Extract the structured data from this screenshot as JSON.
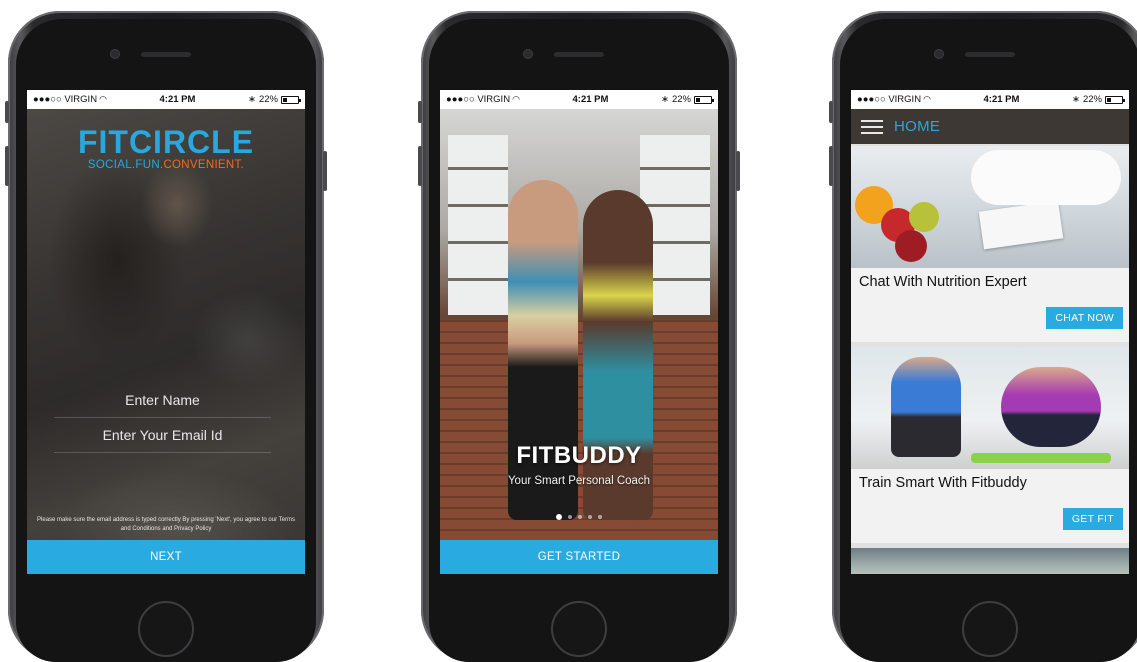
{
  "status_bar": {
    "carrier": "●●●○○ VIRGIN",
    "time": "4:21 PM",
    "battery": "22%",
    "battery_level": 0.22
  },
  "screen_signup": {
    "logo_word": "FITCIRCLE",
    "tagline_part1": "SOCIAL.FUN.",
    "tagline_part2": "CONVENIENT.",
    "name_placeholder": "Enter Name",
    "email_placeholder": "Enter Your Email Id",
    "disclaimer": "Please make sure the email address is typed correctly By pressing 'Next', you agree to our Terms and Conditions and Privacy Policy",
    "next_label": "NEXT"
  },
  "screen_intro": {
    "title": "FITBUDDY",
    "subtitle": "Your Smart Personal Coach",
    "page_count": 5,
    "active_page": 1,
    "cta_label": "GET STARTED"
  },
  "screen_home": {
    "title": "HOME",
    "cards": [
      {
        "title": "Chat With Nutrition Expert",
        "button": "CHAT NOW"
      },
      {
        "title": "Train Smart With Fitbuddy",
        "button": "GET FIT"
      }
    ]
  },
  "colors": {
    "accent_blue": "#29abe2",
    "accent_orange": "#f26b21",
    "appbar_brown": "#3d3833"
  }
}
